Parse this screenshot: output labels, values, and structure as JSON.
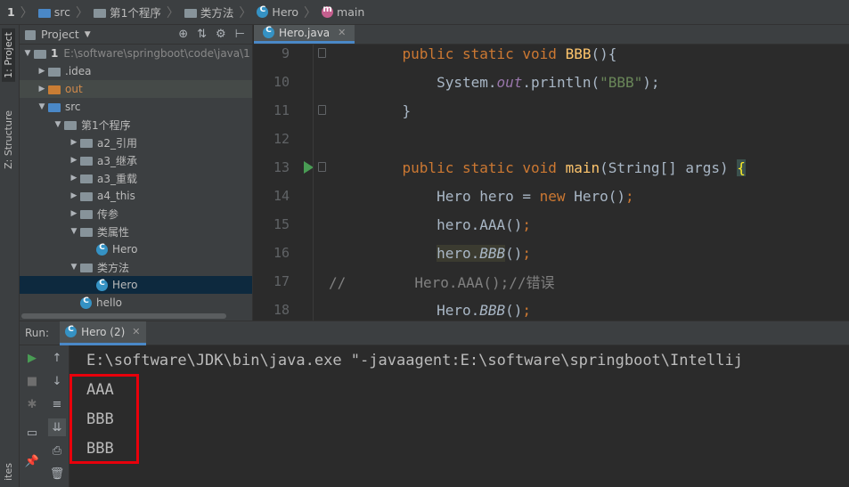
{
  "breadcrumb": {
    "num": "1",
    "items": [
      "src",
      "第1个程序",
      "类方法",
      "Hero",
      "main"
    ]
  },
  "left_strip": {
    "project_label": "1: Project",
    "structure_label": "Z: Structure",
    "bottom_label": "ites"
  },
  "project": {
    "title": "Project",
    "root_num": "1",
    "root_path": "E:\\software\\springboot\\code\\java\\1",
    "tree": [
      {
        "label": ".idea",
        "level": 1,
        "expanded": false
      },
      {
        "label": "out",
        "level": 1,
        "expanded": false
      },
      {
        "label": "src",
        "level": 1,
        "expanded": true
      },
      {
        "label": "第1个程序",
        "level": 2,
        "expanded": true
      },
      {
        "label": "a2_引用",
        "level": 3,
        "expanded": false
      },
      {
        "label": "a3_继承",
        "level": 3,
        "expanded": false
      },
      {
        "label": "a3_重载",
        "level": 3,
        "expanded": false
      },
      {
        "label": "a4_this",
        "level": 3,
        "expanded": false
      },
      {
        "label": "传参",
        "level": 3,
        "expanded": false
      },
      {
        "label": "类属性",
        "level": 3,
        "expanded": true
      },
      {
        "label": "Hero",
        "level": 4
      },
      {
        "label": "类方法",
        "level": 3,
        "expanded": true
      },
      {
        "label": "Hero",
        "level": 4
      },
      {
        "label": "hello",
        "level": 2
      }
    ]
  },
  "editor": {
    "tab_label": "Hero.java",
    "lines": [
      {
        "num": "9",
        "text_parts": [
          [
            "kw",
            "    public static void "
          ],
          [
            "fn",
            "BBB"
          ],
          [
            "plain",
            "(){"
          ]
        ]
      },
      {
        "num": "10",
        "text_parts": [
          [
            "plain",
            "        System."
          ],
          [
            "it",
            "out"
          ],
          [
            "plain",
            ".println("
          ],
          [
            "str",
            "\"BBB\""
          ],
          [
            "plain",
            ");"
          ]
        ]
      },
      {
        "num": "11",
        "text_parts": [
          [
            "plain",
            "    }"
          ]
        ]
      },
      {
        "num": "12",
        "text_parts": []
      },
      {
        "num": "13",
        "text_parts": [
          [
            "kw",
            "    public static void "
          ],
          [
            "fn",
            "main"
          ],
          [
            "plain",
            "(String[] args) "
          ],
          [
            "brace",
            "{"
          ]
        ]
      },
      {
        "num": "14",
        "text_parts": [
          [
            "plain",
            "        Hero hero = "
          ],
          [
            "kw",
            "new "
          ],
          [
            "plain",
            "Hero()"
          ],
          [
            "kw",
            ";"
          ]
        ]
      },
      {
        "num": "15",
        "text_parts": [
          [
            "plain",
            "        hero.AAA()"
          ],
          [
            "kw",
            ";"
          ]
        ]
      },
      {
        "num": "16",
        "text_parts": [
          [
            "plain",
            "        "
          ],
          [
            "hl",
            "hero."
          ],
          [
            "hlit",
            "BBB"
          ],
          [
            "plain",
            "()"
          ],
          [
            "kw",
            ";"
          ]
        ]
      },
      {
        "num": "17",
        "text_parts": [
          [
            "cmt",
            "//        Hero.AAA();//错误"
          ]
        ]
      },
      {
        "num": "18",
        "text_parts": [
          [
            "plain",
            "        Hero."
          ],
          [
            "italic-plain",
            "BBB"
          ],
          [
            "plain",
            "()"
          ],
          [
            "kw",
            ";"
          ]
        ]
      }
    ]
  },
  "run": {
    "label": "Run:",
    "tab_label": "Hero (2)",
    "console_lines": [
      "E:\\software\\JDK\\bin\\java.exe \"-javaagent:E:\\software\\springboot\\Intellij",
      "AAA",
      "BBB",
      "BBB"
    ]
  }
}
